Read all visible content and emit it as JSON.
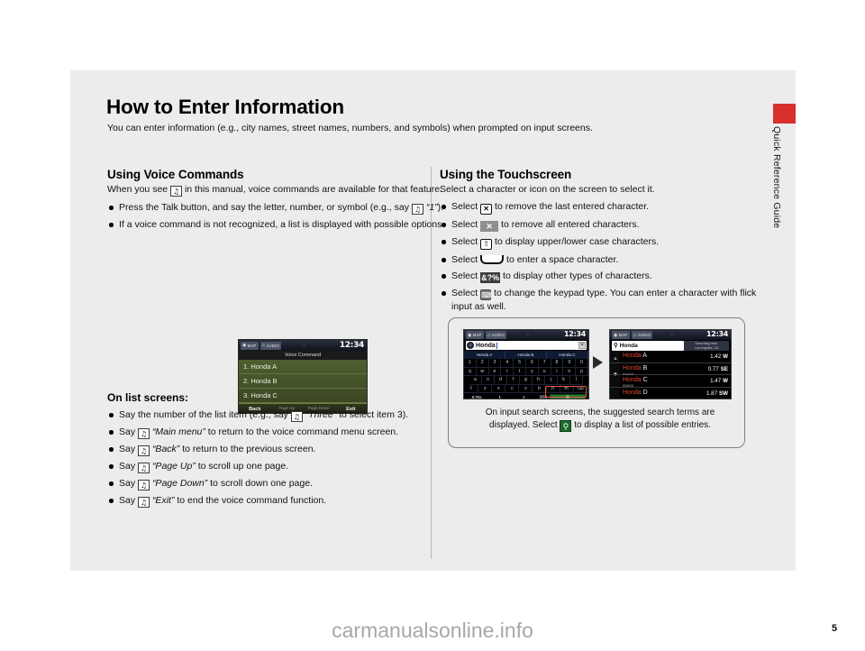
{
  "doc": {
    "title": "How to Enter Information",
    "subtitle": "You can enter information (e.g., city names, street names, numbers, and symbols) when prompted on input screens.",
    "side_label": "Quick Reference Guide",
    "page_number": "5",
    "watermark": "carmanualsonline.info"
  },
  "left": {
    "heading": "Using Voice Commands",
    "lead_before": "When you see",
    "lead_after": "in this manual, voice commands are available for that feature.",
    "bullets": [
      {
        "text_a": "Press the Talk button, and say the letter, number, or symbol (e.g., say",
        "quote": "“1”",
        "text_b": ")."
      },
      {
        "text_a": "If a voice command is not recognized, a list is displayed with possible options.",
        "quote": "",
        "text_b": ""
      }
    ],
    "list_heading": "On list screens:",
    "list_bullets": [
      {
        "pre": "Say the number of the list item (e.g., say",
        "quote": "“Three”",
        "post": "to select item 3)."
      },
      {
        "pre": "Say",
        "quote": "“Main menu”",
        "post": "to return to the voice command menu screen."
      },
      {
        "pre": "Say",
        "quote": "“Back”",
        "post": "to return to the previous screen."
      },
      {
        "pre": "Say",
        "quote": "“Page Up”",
        "post": "to scroll up one page."
      },
      {
        "pre": "Say",
        "quote": "“Page Down”",
        "post": "to scroll down one page."
      },
      {
        "pre": "Say",
        "quote": "“Exit”",
        "post": "to end the voice command function."
      }
    ]
  },
  "voice_screen": {
    "chip_map": "MAP",
    "chip_audio": "AUDIO",
    "time": "12:34",
    "title": "Voice Command",
    "items": [
      "1. Honda A",
      "2. Honda B",
      "3. Honda C"
    ],
    "footer": [
      "Back",
      "Page Up",
      "Page Down",
      "Exit"
    ]
  },
  "right": {
    "heading": "Using the Touchscreen",
    "lead": "Select a character or icon on the screen to select it.",
    "bullets": [
      {
        "pre": "Select",
        "icon": "delete-char-icon",
        "glyph": "✕",
        "post": "to remove the last entered character."
      },
      {
        "pre": "Select",
        "icon": "clear-all-icon",
        "glyph": "✕",
        "post": "to remove all entered characters."
      },
      {
        "pre": "Select",
        "icon": "shift-case-icon",
        "glyph": "⇧",
        "post": "to display upper/lower case characters."
      },
      {
        "pre": "Select",
        "icon": "space-bar-icon",
        "glyph": "",
        "post": "to enter a space character."
      },
      {
        "pre": "Select",
        "icon": "symbols-icon",
        "glyph": "&?%",
        "post": "to display other types of characters."
      },
      {
        "pre": "Select",
        "icon": "keypad-type-icon",
        "glyph": "⌨",
        "post": "to change the keypad type. You can enter a character with flick input as well."
      }
    ]
  },
  "infobox": {
    "caption_a": "On input search screens, the suggested search terms are",
    "caption_b": "displayed. Select",
    "caption_c": "to display a list of possible entries.",
    "search_glyph": "⚲",
    "keyboard_screen": {
      "chip_map": "MAP",
      "chip_audio": "AUDIO",
      "time": "12:34",
      "input_value": "Honda",
      "clear_glyph": "✕",
      "suggestions": [
        "Honda A",
        "Honda B",
        "Honda C"
      ],
      "row1": [
        "1",
        "2",
        "3",
        "4",
        "5",
        "6",
        "7",
        "8",
        "9",
        "0"
      ],
      "row2": [
        "q",
        "w",
        "e",
        "r",
        "t",
        "y",
        "u",
        "i",
        "o",
        "p"
      ],
      "row3": [
        "a",
        "s",
        "d",
        "f",
        "g",
        "h",
        "j",
        "k",
        "l"
      ],
      "row4": [
        "⇧",
        "z",
        "x",
        "c",
        "v",
        "b",
        "n",
        "m",
        "⌫"
      ],
      "symbol_key": "&?%",
      "keypad_key": "⌨",
      "go_key": "⚲"
    },
    "list_screen": {
      "chip_map": "MAP",
      "chip_audio": "AUDIO",
      "time": "12:34",
      "search_value": "Honda",
      "near_line1": "Searching near:",
      "near_line2": "Los Angeles, CA",
      "rows": [
        {
          "name": "Honda",
          "suffix": "A",
          "addr": "",
          "dist": "1.42",
          "dir": "W"
        },
        {
          "name": "Honda",
          "suffix": "B",
          "addr": "AAAAA",
          "dist": "0.77",
          "dir": "SE"
        },
        {
          "name": "Honda",
          "suffix": "C",
          "addr": "BBBBB",
          "dist": "1.47",
          "dir": "W"
        },
        {
          "name": "Honda",
          "suffix": "D",
          "addr": "",
          "dist": "1.87",
          "dir": "SW"
        }
      ]
    }
  },
  "colors": {
    "accent_red": "#d8302c",
    "page_bg": "#ececec",
    "list_green": "#4f5f30",
    "go_green": "#1e7a32"
  }
}
